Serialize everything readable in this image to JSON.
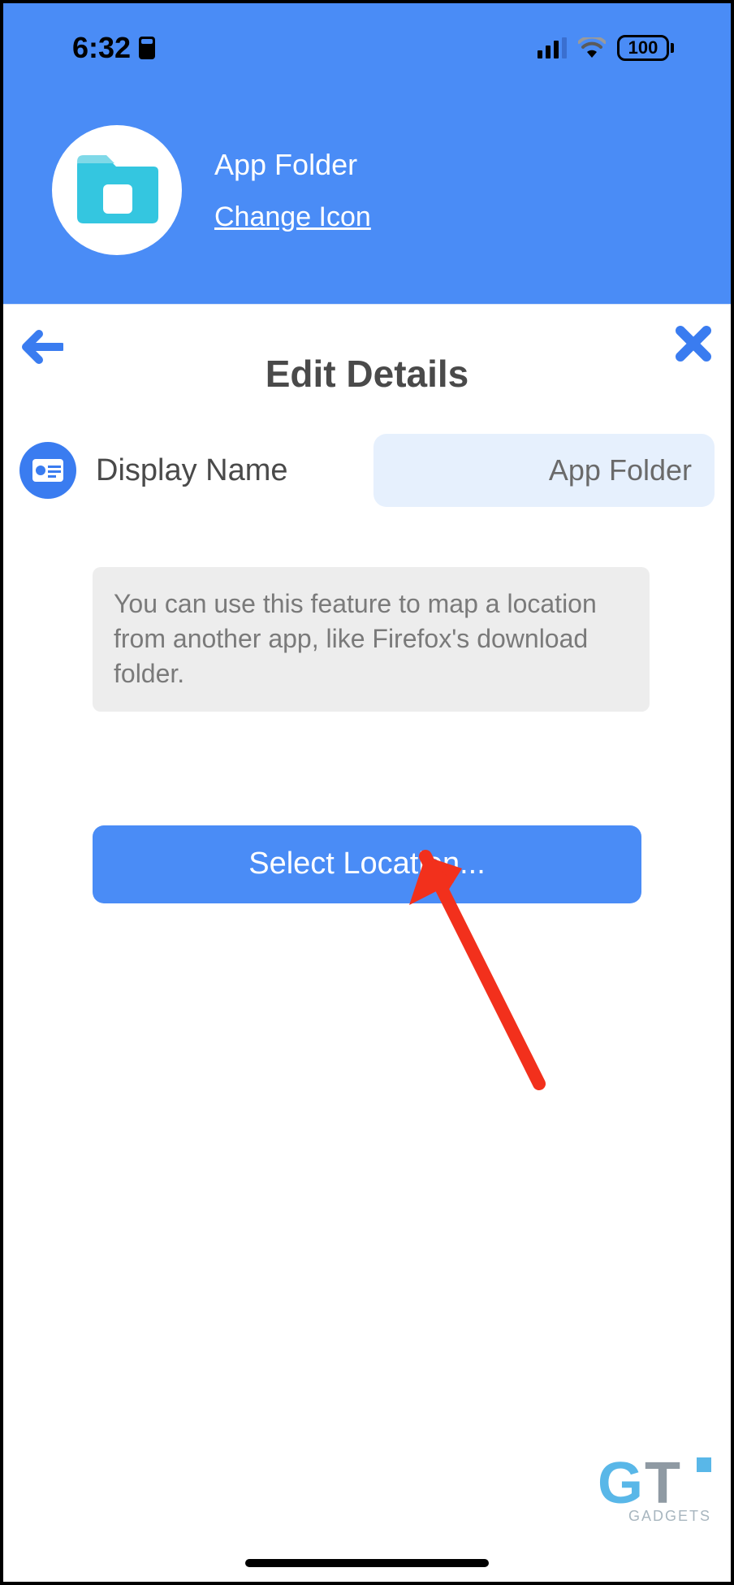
{
  "status": {
    "time": "6:32",
    "battery": "100"
  },
  "header": {
    "title": "App Folder",
    "change_icon_label": "Change Icon"
  },
  "page": {
    "heading": "Edit Details"
  },
  "field": {
    "label": "Display Name",
    "value": "App Folder"
  },
  "hint": {
    "text": "You can use this feature to map a location from another app, like Firefox's download folder."
  },
  "action": {
    "select_location_label": "Select Location..."
  },
  "watermark": {
    "brand": "GADGETS"
  }
}
